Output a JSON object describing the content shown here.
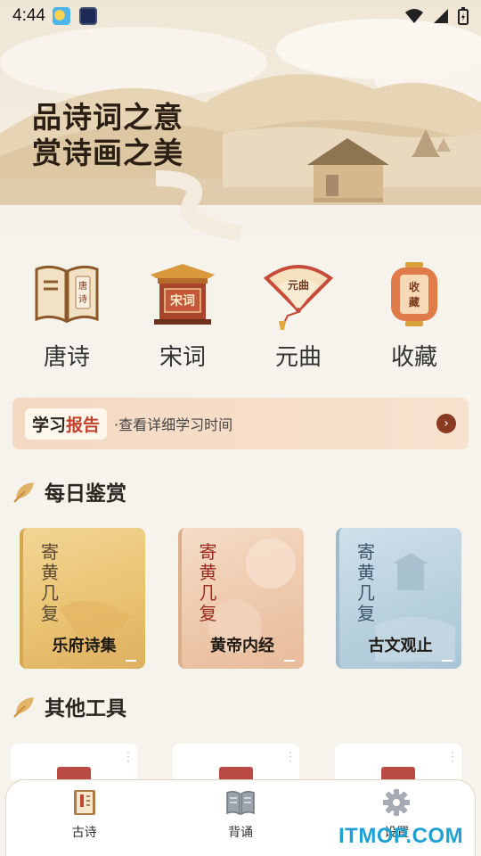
{
  "status_bar": {
    "time": "4:44"
  },
  "hero": {
    "title_line1": "品诗词之意",
    "title_line2": "赏诗画之美"
  },
  "categories": [
    {
      "label": "唐诗",
      "icon": "book-icon",
      "icon_text": "唐诗"
    },
    {
      "label": "宋词",
      "icon": "pavilion-icon",
      "icon_text": "宋词"
    },
    {
      "label": "元曲",
      "icon": "fan-icon",
      "icon_text": "元曲"
    },
    {
      "label": "收藏",
      "icon": "lantern-icon",
      "icon_text": "收藏"
    }
  ],
  "report": {
    "badge_part1": "学习",
    "badge_part2": "报告",
    "description": "·查看详细学习时间",
    "accent_color": "#c3402a"
  },
  "daily": {
    "title": "每日鉴赏",
    "cards": [
      {
        "poem": "寄黄几复",
        "name": "乐府诗集"
      },
      {
        "poem": "寄黄几复",
        "name": "黄帝内经"
      },
      {
        "poem": "寄黄几复",
        "name": "古文观止"
      }
    ]
  },
  "tools": {
    "title": "其他工具"
  },
  "nav": {
    "items": [
      {
        "label": "古诗",
        "icon": "poetry-book-icon",
        "active": true
      },
      {
        "label": "背诵",
        "icon": "open-book-icon",
        "active": false
      },
      {
        "label": "设置",
        "icon": "gear-icon",
        "active": false
      }
    ]
  },
  "watermark": "ITMOP.COM"
}
